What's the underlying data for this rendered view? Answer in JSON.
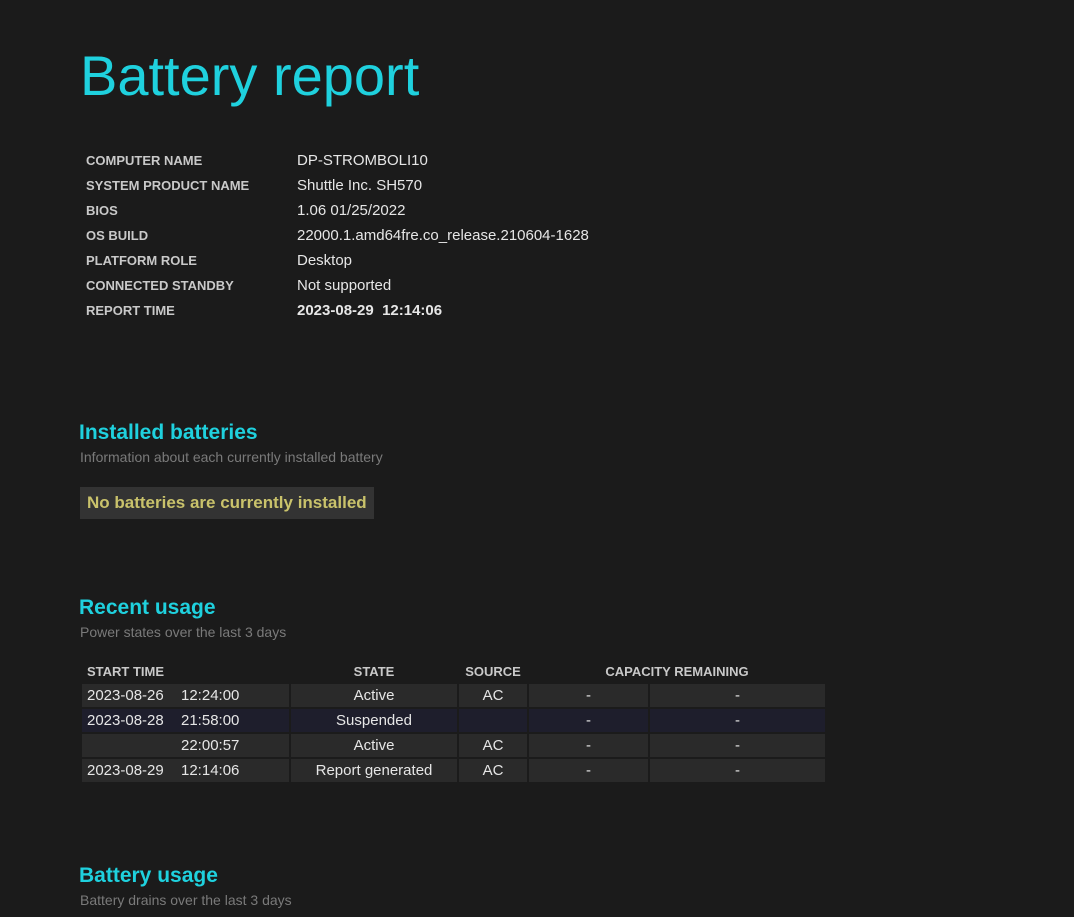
{
  "title": "Battery report",
  "system_info": [
    {
      "label": "COMPUTER NAME",
      "value": "DP-STROMBOLI10"
    },
    {
      "label": "SYSTEM PRODUCT NAME",
      "value": "Shuttle Inc. SH570"
    },
    {
      "label": "BIOS",
      "value": "1.06 01/25/2022"
    },
    {
      "label": "OS BUILD",
      "value": "22000.1.amd64fre.co_release.210604-1628"
    },
    {
      "label": "PLATFORM ROLE",
      "value": "Desktop"
    },
    {
      "label": "CONNECTED STANDBY",
      "value": "Not supported"
    },
    {
      "label": "REPORT TIME",
      "value": "2023-08-29  12:14:06"
    }
  ],
  "installed_batteries": {
    "title": "Installed batteries",
    "subtitle": "Information about each currently installed battery",
    "message": "No batteries are currently installed"
  },
  "recent_usage": {
    "title": "Recent usage",
    "subtitle": "Power states over the last 3 days",
    "columns": {
      "start_time": "START TIME",
      "state": "STATE",
      "source": "SOURCE",
      "capacity": "CAPACITY REMAINING"
    },
    "rows": [
      {
        "date": "2023-08-26",
        "time": "12:24:00",
        "state": "Active",
        "source": "AC",
        "cap_pct": "-",
        "cap_mwh": "-"
      },
      {
        "date": "2023-08-28",
        "time": "21:58:00",
        "state": "Suspended",
        "source": "",
        "cap_pct": "-",
        "cap_mwh": "-"
      },
      {
        "date": "",
        "time": "22:00:57",
        "state": "Active",
        "source": "AC",
        "cap_pct": "-",
        "cap_mwh": "-"
      },
      {
        "date": "2023-08-29",
        "time": "12:14:06",
        "state": "Report generated",
        "source": "AC",
        "cap_pct": "-",
        "cap_mwh": "-"
      }
    ]
  },
  "battery_usage": {
    "title": "Battery usage",
    "subtitle": "Battery drains over the last 3 days"
  }
}
